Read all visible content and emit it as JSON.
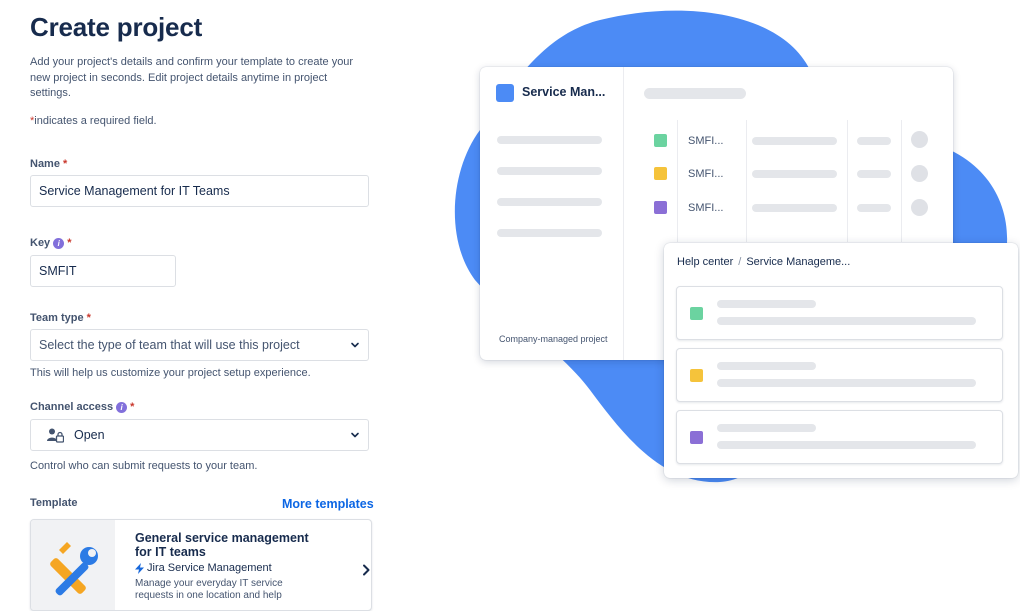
{
  "page": {
    "title": "Create project",
    "description": "Add your project's details and confirm your template to create your new project in seconds. Edit project details anytime in project settings.",
    "required_star": "*",
    "required_note": "indicates a required field."
  },
  "fields": {
    "name": {
      "label": "Name",
      "value": "Service Management for IT Teams"
    },
    "key": {
      "label": "Key",
      "value": "SMFIT"
    },
    "team_type": {
      "label": "Team type",
      "placeholder": "Select the type of team that will use this project",
      "helper": "This will help us customize your project setup experience."
    },
    "channel_access": {
      "label": "Channel access",
      "value": "Open",
      "helper": "Control who can submit requests to your team."
    }
  },
  "template": {
    "label": "Template",
    "more_link": "More templates",
    "card_title": "General service management for IT teams",
    "product": "Jira Service Management",
    "card_desc": "Manage your everyday IT service requests in one location and help"
  },
  "preview": {
    "project_name": "Service Man...",
    "project_type": "Company-managed project",
    "rows": [
      {
        "key": "SMFI...",
        "color": "#6bd3a0"
      },
      {
        "key": "SMFI...",
        "color": "#f5c33b"
      },
      {
        "key": "SMFI...",
        "color": "#8b6fd6"
      }
    ],
    "help_center": {
      "crumb_root": "Help center",
      "crumb_sep": "/",
      "crumb_leaf": "Service Manageme..."
    }
  },
  "colors": {
    "accent": "#0c66e4",
    "blob": "#4c8bf5",
    "required": "#c9372c",
    "info": "#8270db"
  },
  "icons": {
    "info": "info-icon",
    "chevron": "chevron-down-icon",
    "channel": "people-lock-icon",
    "product": "lightning-icon",
    "arrow": "chevron-right-icon",
    "template": "wrench-tools-icon"
  }
}
